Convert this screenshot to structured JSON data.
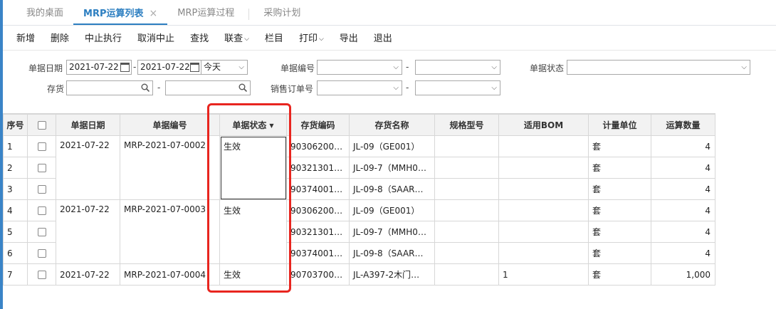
{
  "tabs": [
    {
      "label": "我的桌面",
      "active": false,
      "closable": false
    },
    {
      "label": "MRP运算列表",
      "active": true,
      "closable": true
    },
    {
      "label": "MRP运算过程",
      "active": false,
      "closable": false
    },
    {
      "label": "采购计划",
      "active": false,
      "closable": false
    }
  ],
  "close_glyph": "×",
  "toolbar": [
    {
      "label": "新增",
      "dropdown": false
    },
    {
      "label": "删除",
      "dropdown": false
    },
    {
      "label": "中止执行",
      "dropdown": false
    },
    {
      "label": "取消中止",
      "dropdown": false
    },
    {
      "label": "查找",
      "dropdown": false
    },
    {
      "label": "联查",
      "dropdown": true
    },
    {
      "label": "栏目",
      "dropdown": false
    },
    {
      "label": "打印",
      "dropdown": true
    },
    {
      "label": "导出",
      "dropdown": false
    },
    {
      "label": "退出",
      "dropdown": false
    }
  ],
  "filter": {
    "date_label": "单据日期",
    "date_from": "2021-07-22",
    "date_to": "2021-07-22",
    "date_range": "今天",
    "doc_no_label": "单据编号",
    "status_label": "单据状态",
    "inventory_label": "存货",
    "sales_order_label": "销售订单号",
    "dash": "-"
  },
  "columns": [
    "序号",
    "",
    "单据日期",
    "单据编号",
    "单据状态",
    "存货编码",
    "存货名称",
    "规格型号",
    "适用BOM",
    "计量单位",
    "运算数量"
  ],
  "rows": [
    {
      "seq": "1",
      "date": "2021-07-22",
      "no": "MRP-2021-07-0002",
      "status": "生效",
      "code": "90306200…",
      "name": "JL-09（GE001）",
      "spec": "",
      "bom": "",
      "unit": "套",
      "qty": "4"
    },
    {
      "seq": "2",
      "date": "",
      "no": "",
      "status": "",
      "code": "90321301…",
      "name": "JL-09-7（MMH0…",
      "spec": "",
      "bom": "",
      "unit": "套",
      "qty": "4"
    },
    {
      "seq": "3",
      "date": "",
      "no": "",
      "status": "",
      "code": "90374001…",
      "name": "JL-09-8（SAAR…",
      "spec": "",
      "bom": "",
      "unit": "套",
      "qty": "4"
    },
    {
      "seq": "4",
      "date": "2021-07-22",
      "no": "MRP-2021-07-0003",
      "status": "生效",
      "code": "90306200…",
      "name": "JL-09（GE001）",
      "spec": "",
      "bom": "",
      "unit": "套",
      "qty": "4"
    },
    {
      "seq": "5",
      "date": "",
      "no": "",
      "status": "",
      "code": "90321301…",
      "name": "JL-09-7（MMH0…",
      "spec": "",
      "bom": "",
      "unit": "套",
      "qty": "4"
    },
    {
      "seq": "6",
      "date": "",
      "no": "",
      "status": "",
      "code": "90374001…",
      "name": "JL-09-8（SAAR…",
      "spec": "",
      "bom": "",
      "unit": "套",
      "qty": "4"
    },
    {
      "seq": "7",
      "date": "2021-07-22",
      "no": "MRP-2021-07-0004",
      "status": "生效",
      "code": "90703700…",
      "name": "JL-A397-2木门…",
      "spec": "",
      "bom": "1",
      "unit": "套",
      "qty": "1,000"
    }
  ],
  "colors": {
    "accent": "#2d7fc1",
    "highlight": "#e8251f"
  }
}
